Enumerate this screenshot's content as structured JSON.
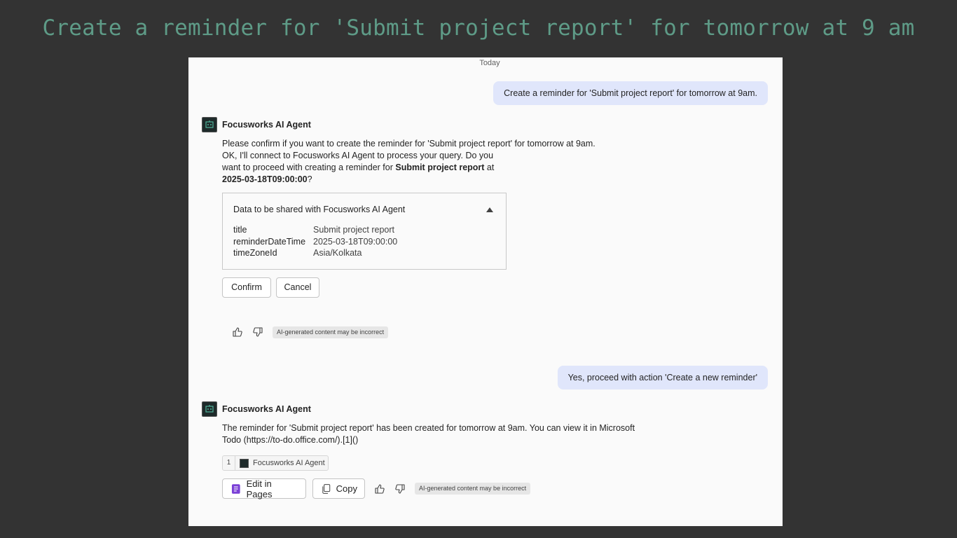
{
  "headline": "Create a reminder for 'Submit project report' for tomorrow at 9 am",
  "chat": {
    "date_separator": "Today",
    "user_message_1": "Create a reminder for 'Submit project report' for tomorrow at 9am.",
    "agent_name": "Focusworks AI Agent",
    "agent_reply_1": {
      "line1": "Please confirm if you want to create the reminder for 'Submit project report' for tomorrow at 9am.",
      "line2": "OK, I'll connect to Focusworks AI Agent to process your query. Do you",
      "line3_prefix": "want to proceed with creating a reminder for ",
      "line3_bold": "Submit project report",
      "line3_suffix": " at",
      "line4_bold": "2025-03-18T09:00:00",
      "line4_suffix": "?"
    },
    "data_card": {
      "title": "Data to be shared with Focusworks AI Agent",
      "rows": [
        {
          "key": "title",
          "value": "Submit project report"
        },
        {
          "key": "reminderDateTime",
          "value": "2025-03-18T09:00:00"
        },
        {
          "key": "timeZoneId",
          "value": "Asia/Kolkata"
        }
      ]
    },
    "confirm_label": "Confirm",
    "cancel_label": "Cancel",
    "disclaimer": "AI-generated content may be incorrect",
    "user_message_2": "Yes, proceed with action 'Create a new reminder'",
    "agent_reply_2": {
      "line1": "The reminder for 'Submit project report' has been created for tomorrow at 9am. You can view it in Microsoft",
      "line2": "Todo (https://to-do.office.com/).[1]()"
    },
    "citation": {
      "number": "1",
      "label": "Focusworks AI Agent"
    },
    "edit_in_pages_label": "Edit in Pages",
    "copy_label": "Copy",
    "colors": {
      "user_bubble": "#e0e6fb",
      "pages_icon": "#7a3fd6"
    }
  }
}
